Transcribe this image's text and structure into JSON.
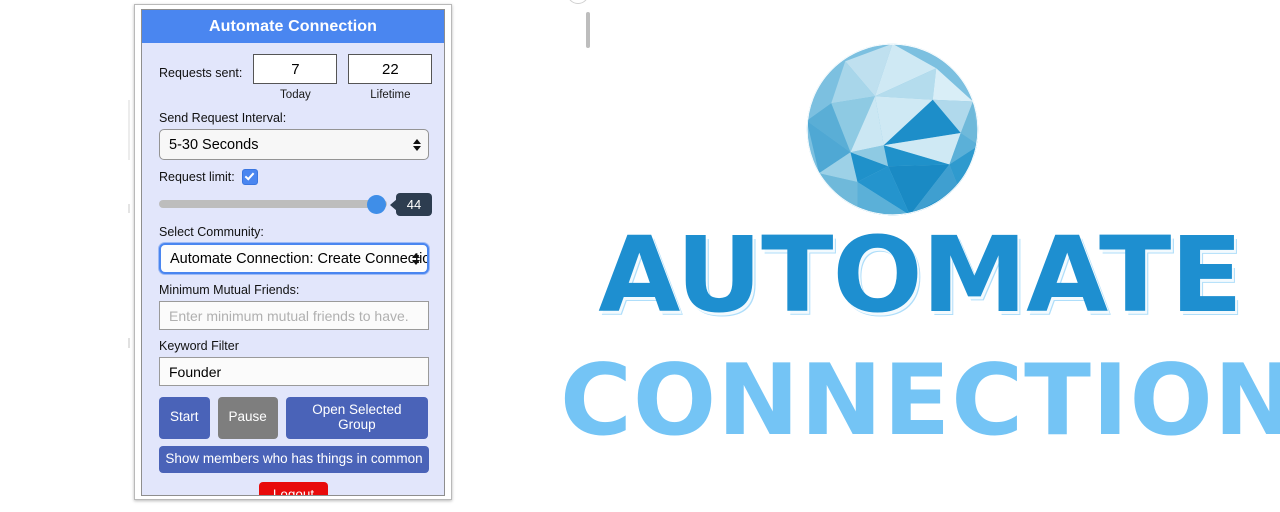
{
  "popup": {
    "header_title": "Automate Connection",
    "requests": {
      "label": "Requests sent:",
      "today_value": "7",
      "today_caption": "Today",
      "lifetime_value": "22",
      "lifetime_caption": "Lifetime"
    },
    "interval": {
      "label": "Send Request Interval:",
      "selected": "5-30 Seconds"
    },
    "request_limit": {
      "label": "Request limit:",
      "checked": true,
      "slider_value": "44"
    },
    "community": {
      "label": "Select Community:",
      "selected": "Automate Connection: Create Connections"
    },
    "mutual_friends": {
      "label": "Minimum Mutual Friends:",
      "placeholder": "Enter minimum mutual friends to have.",
      "value": ""
    },
    "keyword_filter": {
      "label": "Keyword Filter",
      "value": "Founder"
    },
    "buttons": {
      "start": "Start",
      "pause": "Pause",
      "open_group": "Open Selected Group",
      "show_members": "Show members who has things in common",
      "logout": "Logout"
    }
  },
  "brand": {
    "wordmark_top": "AUTOMATE",
    "wordmark_bottom": "CONNECTION",
    "logo_name": "low-poly-sphere-logo"
  },
  "colors": {
    "header_blue": "#4a86f0",
    "panel_bg": "#e2e6fb",
    "button_blue": "#4a63b8",
    "button_grey": "#7e7e7e",
    "logout_red": "#e80b0b",
    "slider_thumb": "#3f8ee8",
    "tooltip_bg": "#2d3d50",
    "brand_dark_blue": "#1e8fd0",
    "brand_light_blue": "#74c4f5"
  }
}
